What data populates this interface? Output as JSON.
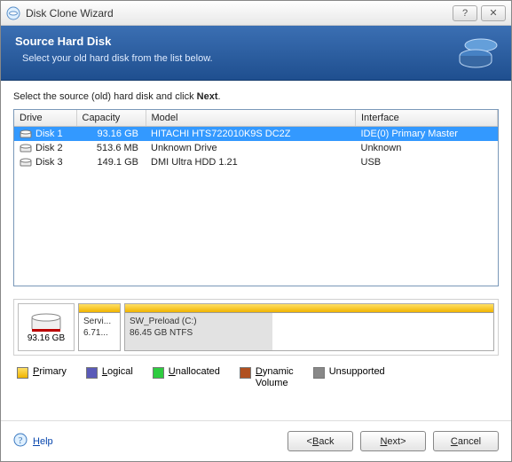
{
  "window": {
    "title": "Disk Clone Wizard"
  },
  "banner": {
    "title": "Source Hard Disk",
    "subtitle": "Select your old hard disk from the list below."
  },
  "instruction_prefix": "Select the source (old) hard disk and click ",
  "instruction_bold": "Next",
  "instruction_suffix": ".",
  "columns": {
    "drive": "Drive",
    "capacity": "Capacity",
    "model": "Model",
    "interface": "Interface"
  },
  "rows": [
    {
      "drive": "Disk 1",
      "capacity": "93.16 GB",
      "model": "HITACHI HTS722010K9S DC2Z",
      "interface": "IDE(0) Primary Master",
      "selected": true
    },
    {
      "drive": "Disk 2",
      "capacity": "513.6 MB",
      "model": "Unknown Drive",
      "interface": "Unknown",
      "selected": false
    },
    {
      "drive": "Disk 3",
      "capacity": "149.1 GB",
      "model": "DMI Ultra HDD 1.21",
      "interface": "USB",
      "selected": false
    }
  ],
  "disk_summary": {
    "size": "93.16 GB"
  },
  "partitions": {
    "p0": {
      "name": "Servi...",
      "size": "6.71..."
    },
    "p1": {
      "name": "SW_Preload (C:)",
      "size": "86.45 GB  NTFS"
    }
  },
  "legend": {
    "primary": "Primary",
    "logical": "Logical",
    "unallocated": "Unallocated",
    "dynamic_line1": "Dynamic",
    "dynamic_line2": "Volume",
    "unsupported": "Unsupported"
  },
  "footer": {
    "help": "Help",
    "back": "Back",
    "next": "Next",
    "cancel": "Cancel"
  }
}
